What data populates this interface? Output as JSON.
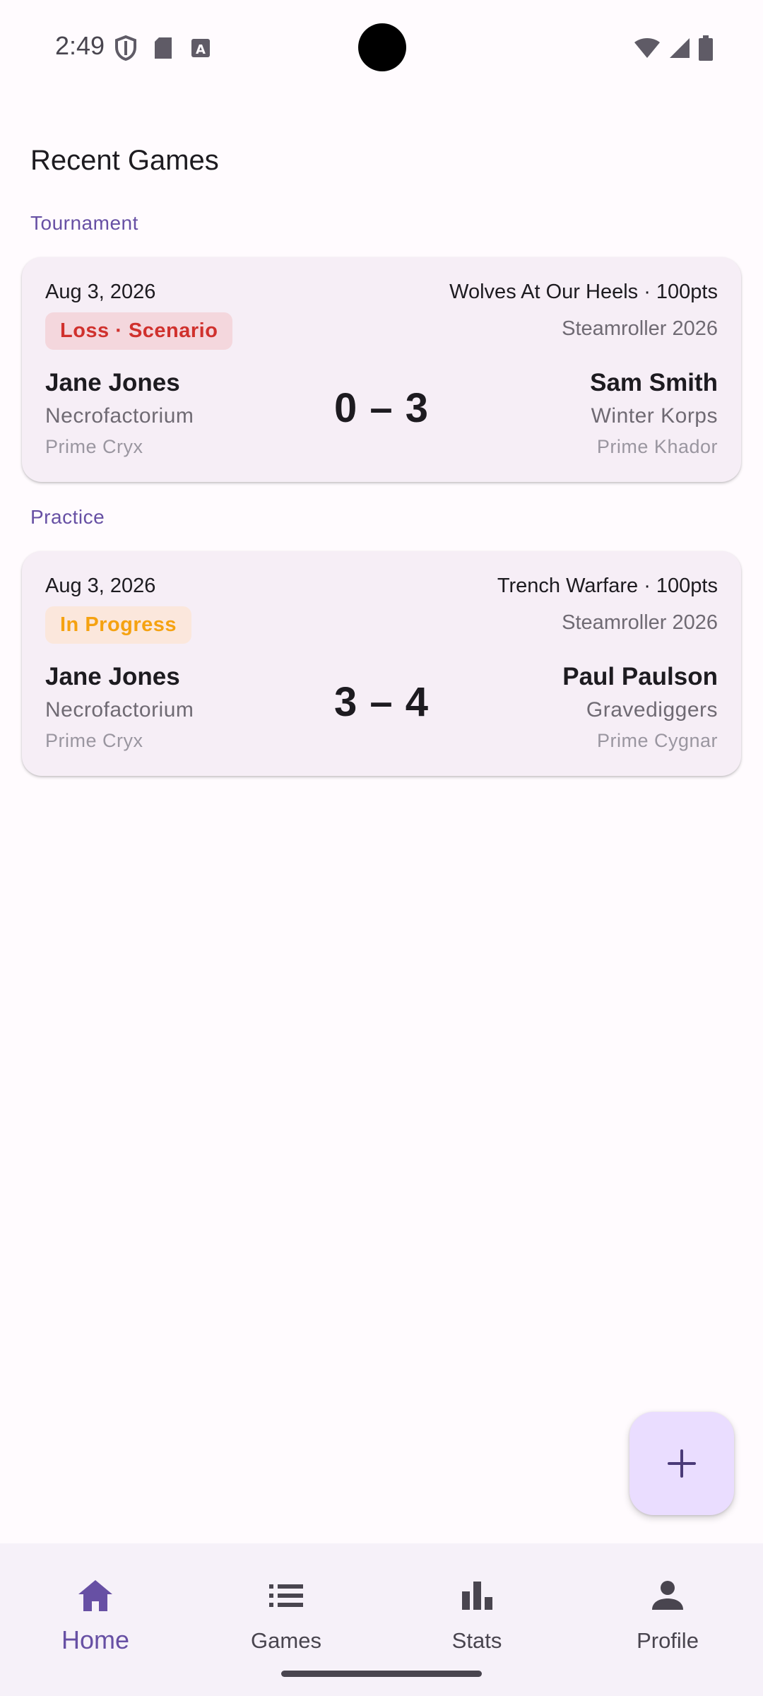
{
  "status_bar": {
    "time": "2:49"
  },
  "page": {
    "title": "Recent Games"
  },
  "sections": [
    {
      "label": "Tournament",
      "card": {
        "date": "Aug 3, 2026",
        "mission": "Wolves At Our Heels · 100pts",
        "badge": "Loss · Scenario",
        "event": "Steamroller 2026",
        "player1": {
          "name": "Jane Jones",
          "army": "Necrofactorium",
          "faction": "Prime Cryx"
        },
        "score": "0 – 3",
        "player2": {
          "name": "Sam Smith",
          "army": "Winter Korps",
          "faction": "Prime Khador"
        }
      }
    },
    {
      "label": "Practice",
      "card": {
        "date": "Aug 3, 2026",
        "mission": "Trench Warfare · 100pts",
        "badge": "In Progress",
        "event": "Steamroller 2026",
        "player1": {
          "name": "Jane Jones",
          "army": "Necrofactorium",
          "faction": "Prime Cryx"
        },
        "score": "3 – 4",
        "player2": {
          "name": "Paul Paulson",
          "army": "Gravediggers",
          "faction": "Prime Cygnar"
        }
      }
    }
  ],
  "fab": {
    "icon": "plus-icon"
  },
  "bottom_nav": {
    "items": [
      {
        "label": "Home",
        "icon": "home-icon",
        "active": true
      },
      {
        "label": "Games",
        "icon": "list-icon",
        "active": false
      },
      {
        "label": "Stats",
        "icon": "bar-chart-icon",
        "active": false
      },
      {
        "label": "Profile",
        "icon": "person-icon",
        "active": false
      }
    ]
  },
  "colors": {
    "primary": "#6750a4",
    "card_bg": "#f6eef6",
    "loss": "#d0312d",
    "in_progress": "#f5a211",
    "fab_bg": "#eaddff"
  }
}
